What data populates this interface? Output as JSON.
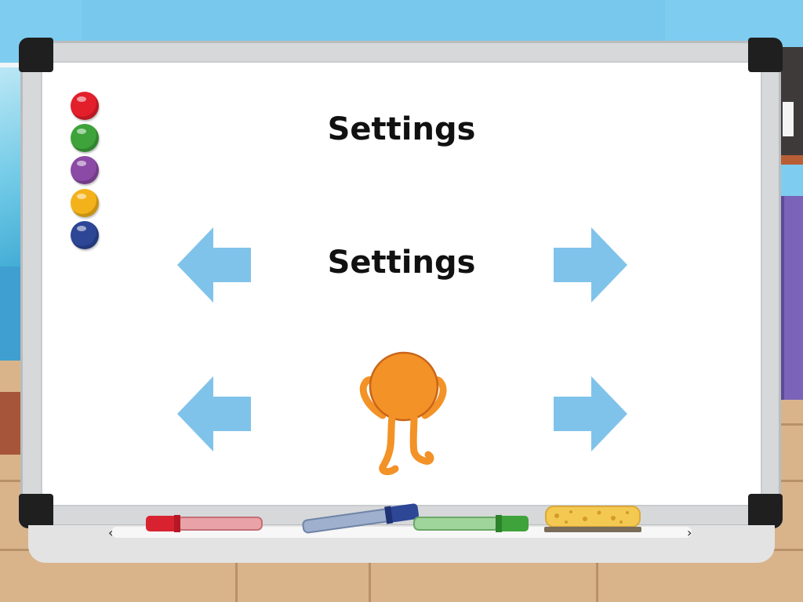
{
  "screen": {
    "title": "Settings",
    "subtitle": "Settings"
  },
  "magnets": [
    {
      "name": "red-magnet",
      "color": "#e21f2b"
    },
    {
      "name": "green-magnet",
      "color": "#3ea33a"
    },
    {
      "name": "purple-magnet",
      "color": "#8b4aa5"
    },
    {
      "name": "yellow-magnet",
      "color": "#f4b21a"
    },
    {
      "name": "blue-magnet",
      "color": "#2d4695"
    }
  ],
  "colors": {
    "arrow": "#80c3ea",
    "character": "#f39226",
    "character_outline": "#c9651a"
  },
  "icons": {
    "prev_top": "left-arrow-icon",
    "next_top": "right-arrow-icon",
    "prev_bottom": "left-arrow-icon",
    "next_bottom": "right-arrow-icon",
    "character": "orange-character-icon"
  }
}
